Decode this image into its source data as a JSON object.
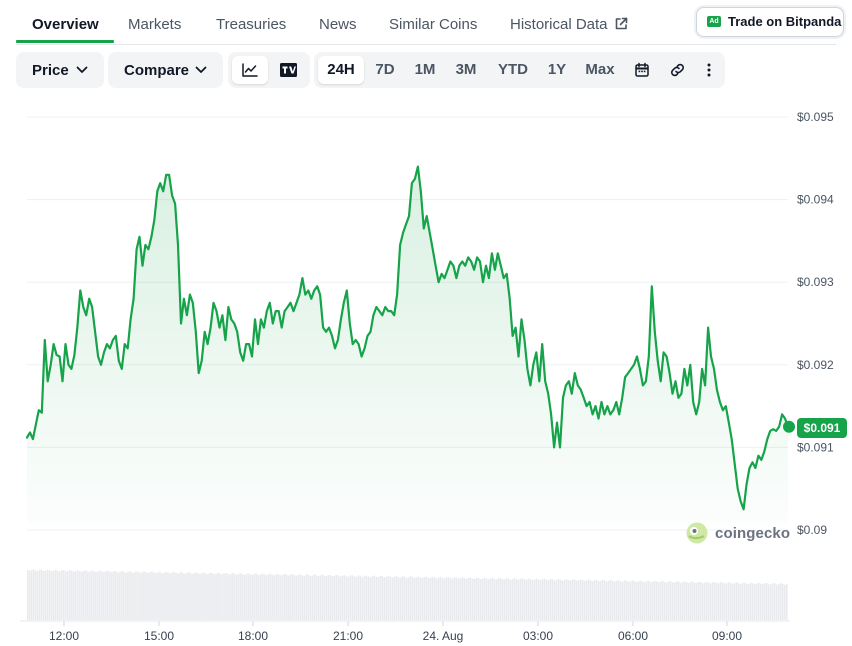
{
  "nav": {
    "tabs": [
      {
        "label": "Overview",
        "active": true
      },
      {
        "label": "Markets"
      },
      {
        "label": "Treasuries"
      },
      {
        "label": "News"
      },
      {
        "label": "Similar Coins"
      },
      {
        "label": "Historical Data",
        "icon": "external-link-icon"
      }
    ],
    "trade_button": {
      "ad_badge": "Ad",
      "label": "Trade on Bitpanda"
    }
  },
  "toolbar": {
    "price_dropdown": "Price",
    "compare_dropdown": "Compare",
    "chart_views": [
      "line-chart-icon",
      "tradingview-icon"
    ],
    "selected_view": "line-chart-icon",
    "ranges": [
      "24H",
      "7D",
      "1M",
      "3M",
      "YTD",
      "1Y",
      "Max"
    ],
    "selected_range": "24H",
    "icons": [
      "calendar-icon",
      "link-icon",
      "more-vertical-icon"
    ]
  },
  "chart_data": {
    "type": "area",
    "ylim": [
      0.0897,
      0.0952
    ],
    "y_ticks": [
      0.09,
      0.091,
      0.092,
      0.093,
      0.094,
      0.095
    ],
    "y_tick_labels": [
      "$0.09",
      "$0.091",
      "$0.092",
      "$0.093",
      "$0.094",
      "$0.095"
    ],
    "x_labels": [
      "12:00",
      "15:00",
      "18:00",
      "21:00",
      "24. Aug",
      "03:00",
      "06:00",
      "09:00"
    ],
    "current_price_label": "$0.091",
    "grid": true,
    "color": "#16a34a",
    "series": [
      {
        "values": [
          0.09112,
          0.09118,
          0.0911,
          0.09128,
          0.09145,
          0.09142,
          0.0923,
          0.0918,
          0.092,
          0.09225,
          0.09212,
          0.0921,
          0.0918,
          0.09225,
          0.092,
          0.09195,
          0.09212,
          0.09245,
          0.0929,
          0.0927,
          0.0926,
          0.0928,
          0.0927,
          0.0924,
          0.0921,
          0.092,
          0.09215,
          0.09225,
          0.0922,
          0.0923,
          0.09235,
          0.09205,
          0.09195,
          0.09225,
          0.0922,
          0.09255,
          0.0928,
          0.0934,
          0.09355,
          0.0932,
          0.09345,
          0.0934,
          0.09355,
          0.09375,
          0.0941,
          0.0942,
          0.0941,
          0.0943,
          0.0943,
          0.09405,
          0.09395,
          0.09345,
          0.0925,
          0.0928,
          0.0926,
          0.09285,
          0.09275,
          0.0924,
          0.0919,
          0.09205,
          0.0924,
          0.09225,
          0.09245,
          0.09275,
          0.09265,
          0.09245,
          0.0926,
          0.0923,
          0.0927,
          0.09255,
          0.0925,
          0.0924,
          0.09215,
          0.09205,
          0.09225,
          0.09225,
          0.0921,
          0.09255,
          0.09225,
          0.09255,
          0.09245,
          0.09265,
          0.09275,
          0.0925,
          0.09265,
          0.09265,
          0.09245,
          0.09265,
          0.0927,
          0.09275,
          0.09265,
          0.09275,
          0.09285,
          0.09305,
          0.09285,
          0.0929,
          0.0928,
          0.0929,
          0.09295,
          0.09285,
          0.09245,
          0.0924,
          0.09245,
          0.09235,
          0.0922,
          0.0923,
          0.09255,
          0.09275,
          0.0929,
          0.0925,
          0.09225,
          0.0923,
          0.09225,
          0.0921,
          0.0922,
          0.09235,
          0.0924,
          0.0926,
          0.0927,
          0.09265,
          0.0926,
          0.0927,
          0.09265,
          0.09265,
          0.0926,
          0.09285,
          0.09345,
          0.0936,
          0.0937,
          0.0938,
          0.0942,
          0.09425,
          0.0944,
          0.0941,
          0.09365,
          0.0938,
          0.0936,
          0.0934,
          0.0932,
          0.093,
          0.0931,
          0.09305,
          0.09315,
          0.09325,
          0.0932,
          0.09305,
          0.0932,
          0.09325,
          0.0932,
          0.0933,
          0.09325,
          0.09315,
          0.0933,
          0.09325,
          0.093,
          0.0932,
          0.09305,
          0.09335,
          0.09315,
          0.09335,
          0.0932,
          0.09305,
          0.0931,
          0.0928,
          0.09235,
          0.09245,
          0.0921,
          0.09255,
          0.0923,
          0.09195,
          0.09175,
          0.092,
          0.09215,
          0.0918,
          0.09225,
          0.0918,
          0.09165,
          0.0914,
          0.091,
          0.0913,
          0.091,
          0.0916,
          0.09175,
          0.0918,
          0.09165,
          0.0919,
          0.09175,
          0.0917,
          0.0916,
          0.0915,
          0.09155,
          0.0914,
          0.0915,
          0.09135,
          0.09155,
          0.0914,
          0.0915,
          0.0914,
          0.09145,
          0.09155,
          0.0914,
          0.0916,
          0.09185,
          0.0919,
          0.09195,
          0.092,
          0.0921,
          0.09195,
          0.09175,
          0.0918,
          0.0921,
          0.09295,
          0.0924,
          0.09205,
          0.0918,
          0.09215,
          0.0921,
          0.0919,
          0.09165,
          0.0918,
          0.0916,
          0.09165,
          0.09195,
          0.09175,
          0.092,
          0.09155,
          0.0914,
          0.09155,
          0.09195,
          0.09175,
          0.09245,
          0.0921,
          0.09195,
          0.0917,
          0.09155,
          0.09145,
          0.0915,
          0.0913,
          0.0911,
          0.0908,
          0.0905,
          0.09035,
          0.09025,
          0.09055,
          0.09075,
          0.09082,
          0.09075,
          0.0909,
          0.09085,
          0.09095,
          0.0911,
          0.0912,
          0.09122,
          0.0912,
          0.09125,
          0.0914,
          0.09135,
          0.09125
        ]
      }
    ],
    "volume_bars": 380
  },
  "watermark": "coingecko"
}
